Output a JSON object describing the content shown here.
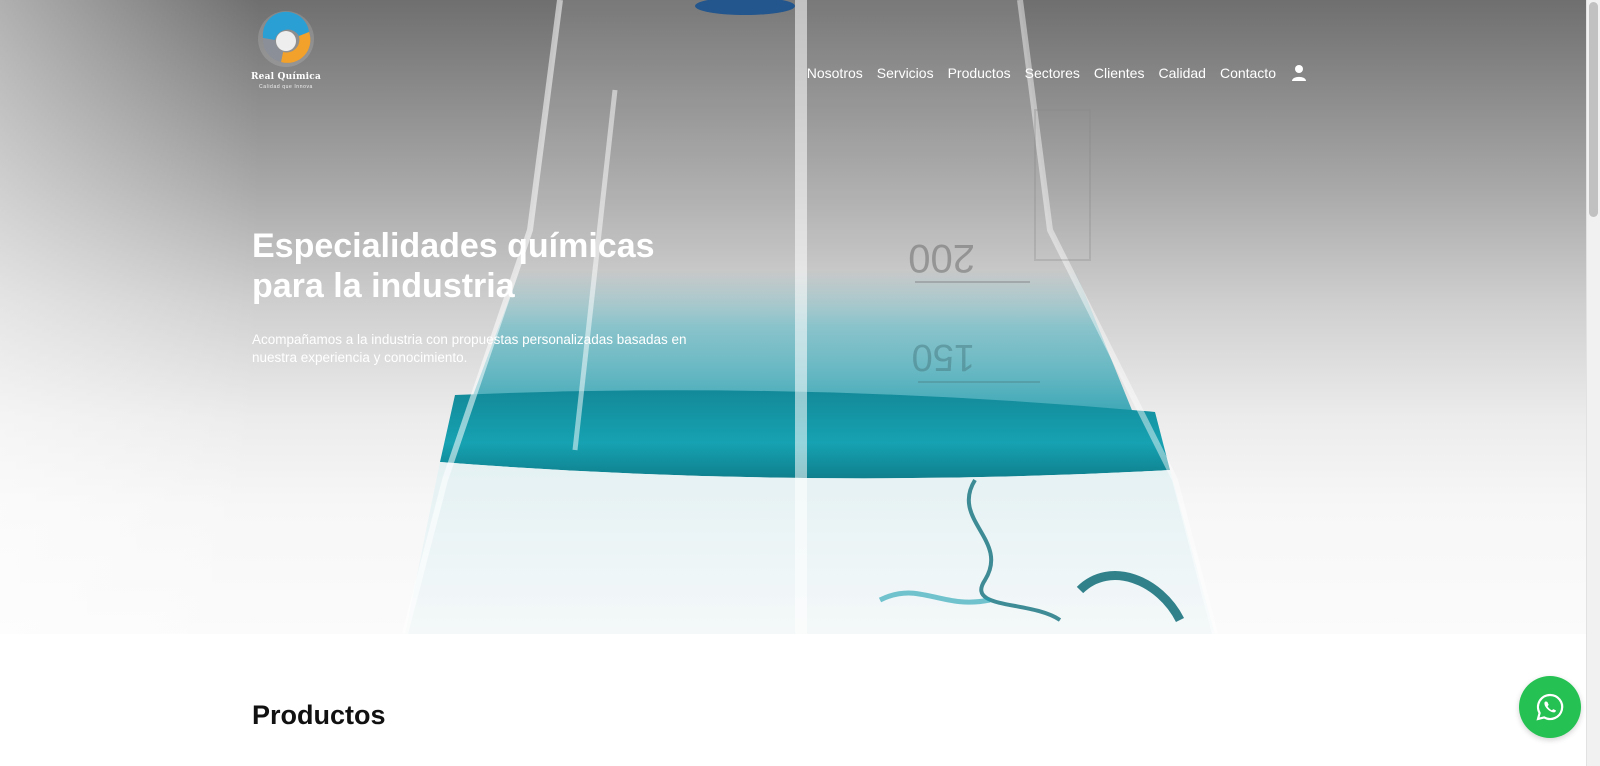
{
  "brand": {
    "name": "Real Química",
    "tagline": "Calidad que Innova"
  },
  "nav": {
    "items": [
      {
        "label": "Nosotros"
      },
      {
        "label": "Servicios"
      },
      {
        "label": "Productos"
      },
      {
        "label": "Sectores"
      },
      {
        "label": "Clientes"
      },
      {
        "label": "Calidad"
      },
      {
        "label": "Contacto"
      }
    ],
    "user_icon": "user-icon"
  },
  "hero": {
    "title_line1": "Especialidades químicas",
    "title_line2": "para la industria",
    "subtitle_line1": "Acompañamos a la industria con propuestas personalizadas basadas en",
    "subtitle_line2": "nuestra experiencia y conocimiento.",
    "flask_marks": [
      "200",
      "150"
    ]
  },
  "products": {
    "title": "Productos"
  },
  "whatsapp": {
    "icon": "whatsapp-icon",
    "color": "#25c152"
  },
  "colors": {
    "liquid": "#1ea3b5",
    "liquid_dark": "#12707d"
  }
}
